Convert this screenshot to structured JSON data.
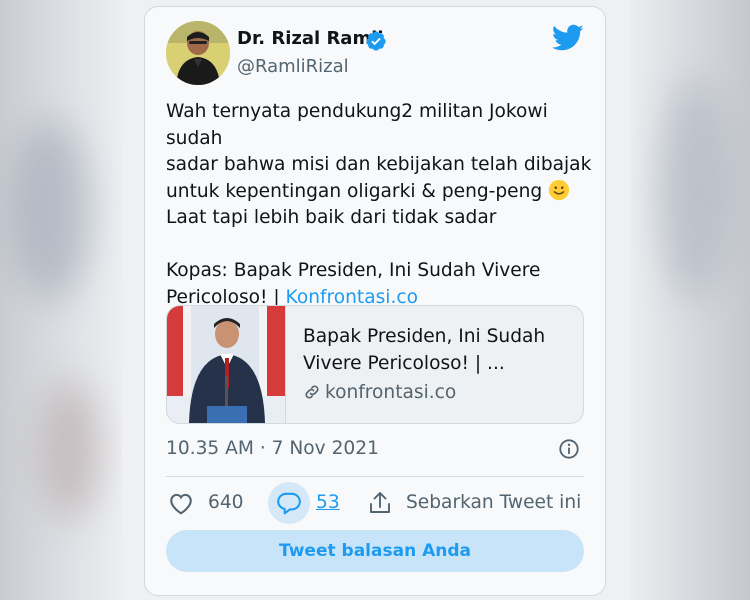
{
  "tweet": {
    "author_name": "Dr. Rizal Ramli",
    "author_handle": "@RamliRizal",
    "text_line1": "Wah ternyata pendukung2 militan Jokowi sudah",
    "text_line2": "sadar bahwa misi dan kebijakan telah dibajak",
    "text_line3": "untuk kepentingan oligarki & peng-peng",
    "text_line4": "Laat tapi lebih baik dari tidak sadar",
    "text_line5": "Kopas: Bapak Presiden, Ini Sudah Vivere",
    "text_line6_prefix": "Pericoloso! | ",
    "text_link": "Konfrontasi.co",
    "timestamp": "10.35 AM · 7 Nov 2021"
  },
  "link_card": {
    "title_line1": "Bapak Presiden, Ini Sudah",
    "title_line2": "Vivere Pericoloso! | ...",
    "domain": "konfrontasi.co"
  },
  "actions": {
    "like_count": "640",
    "reply_count": "53",
    "share_label": "Sebarkan Tweet ini",
    "reply_button": "Tweet balasan Anda"
  },
  "colors": {
    "accent": "#1d9bf0",
    "text": "#0f1419",
    "secondary": "#536471"
  },
  "icons": [
    "twitter-bird-icon",
    "verified-badge-icon",
    "smiley-emoji-icon",
    "link-icon",
    "info-icon",
    "like-heart-icon",
    "reply-bubble-icon",
    "share-icon"
  ]
}
